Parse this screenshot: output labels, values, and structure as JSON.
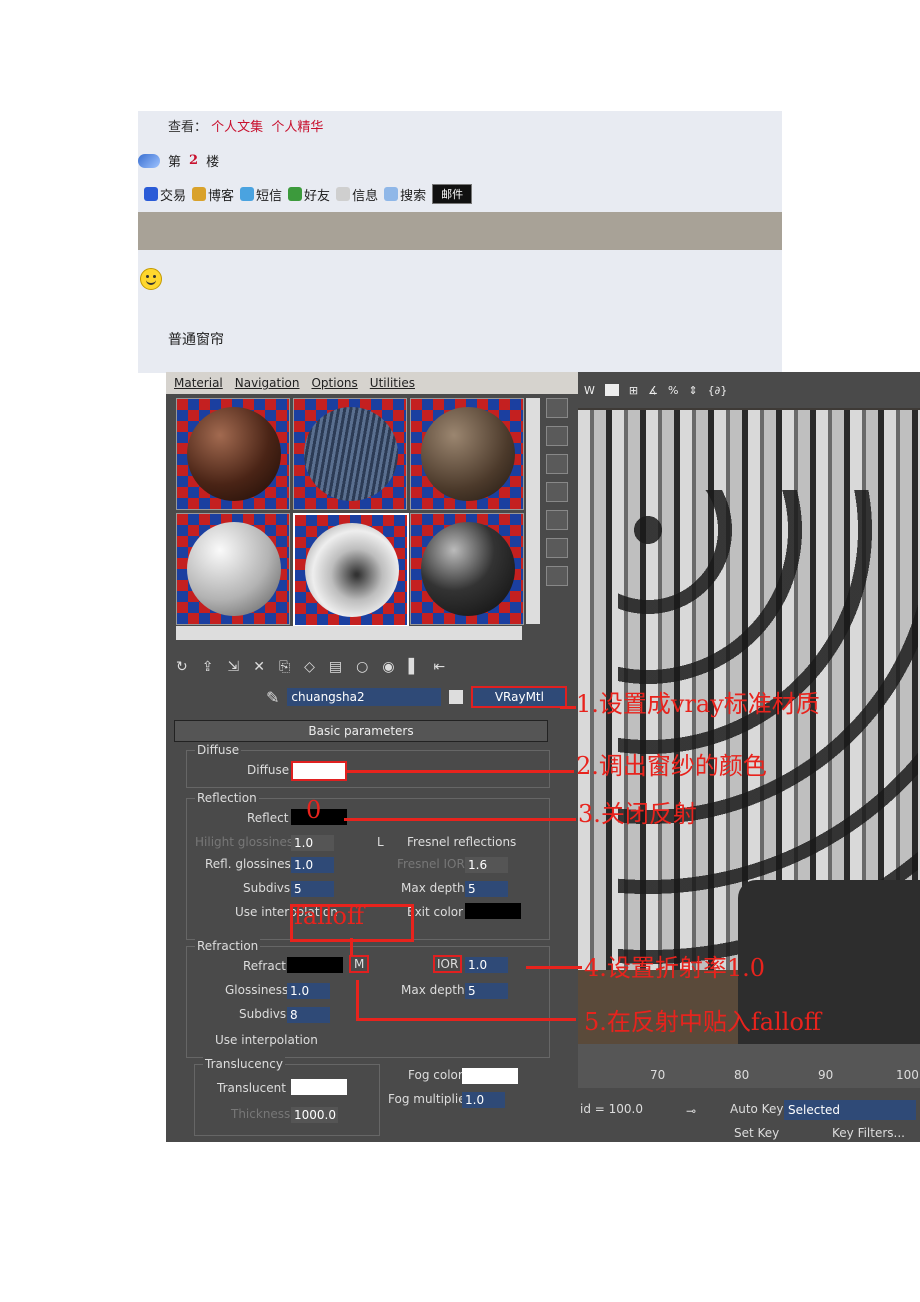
{
  "post": {
    "view_label": "查看：",
    "view_link1": "个人文集",
    "view_link2": "个人精华",
    "floor_prefix": "第",
    "floor_num": "2",
    "floor_suffix": "楼",
    "toolbar": [
      "交易",
      "博客",
      "短信",
      "好友",
      "信息",
      "搜索"
    ],
    "mail": "邮件",
    "caption": "普通窗帘"
  },
  "editor": {
    "menu": [
      "Material",
      "Navigation",
      "Options",
      "Utilities"
    ],
    "material_name": "chuangsha2",
    "material_type": "VRayMtl",
    "rollout_title": "Basic parameters",
    "diffuse_group": "Diffuse",
    "diffuse_label": "Diffuse",
    "reflection_group": "Reflection",
    "reflect_label": "Reflect",
    "hilight_gloss_label": "Hilight glossiness",
    "hilight_gloss_value": "1.0",
    "l_button": "L",
    "fresnel_label": "Fresnel reflections",
    "refl_gloss_label": "Refl. glossiness",
    "refl_gloss_value": "1.0",
    "fresnel_ior_label": "Fresnel IOR",
    "fresnel_ior_value": "1.6",
    "subdivs_label": "Subdivs",
    "refl_subdivs_value": "5",
    "max_depth_label": "Max depth",
    "refl_max_depth_value": "5",
    "use_interp_label": "Use interpolation",
    "exit_color_label": "Exit color",
    "refraction_group": "Refraction",
    "refract_label": "Refract",
    "m_button": "M",
    "ior_label": "IOR",
    "ior_value": "1.0",
    "glossiness_label": "Glossiness",
    "refr_gloss_value": "1.0",
    "refr_max_depth_value": "5",
    "refr_subdivs_value": "8",
    "translucency_group": "Translucency",
    "translucent_label": "Translucent",
    "thickness_label": "Thickness",
    "thickness_value": "1000.0",
    "fog_color_label": "Fog color",
    "fog_mult_label": "Fog multiplier",
    "fog_mult_value": "1.0"
  },
  "viewport": {
    "label": "W",
    "tick_70": "70",
    "tick_80": "80",
    "tick_90": "90",
    "tick_100": "100",
    "grid_label": "id = 100.0",
    "auto_key": "Auto Key",
    "selected": "Selected",
    "set_key": "Set Key",
    "key_filters": "Key Filters..."
  },
  "annotations": {
    "a1": "1.设置成vray标准材质",
    "a2": "2.调出窗纱的颜色",
    "a3": "3.关闭反射",
    "a3_zero": "0",
    "a4": "4.设置折射率1.0",
    "a5": "5.在反射中贴入falloff",
    "falloff": "falloff"
  },
  "colors": {
    "annotation": "#e8231d",
    "post_bg": "#e8ebf2",
    "post_bar": "#a8a297",
    "link": "#c8102e"
  }
}
